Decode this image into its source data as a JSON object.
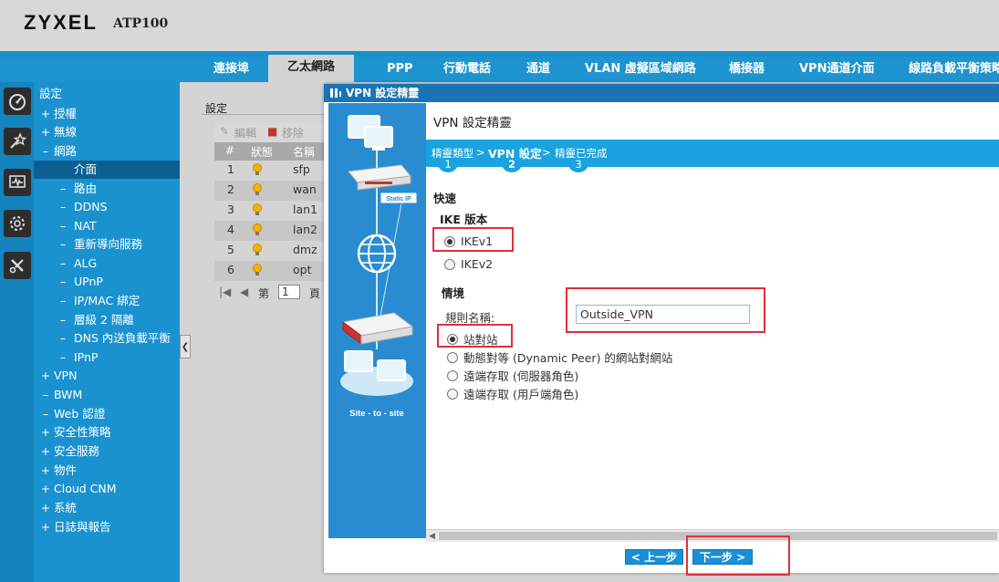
{
  "header": {
    "brand": "ZYXEL",
    "model": "ATP100"
  },
  "tabs": [
    {
      "label": "連接埠",
      "active": false
    },
    {
      "label": "乙太網路",
      "active": true
    },
    {
      "label": "PPP",
      "active": false
    },
    {
      "label": "行動電話",
      "active": false
    },
    {
      "label": "通道",
      "active": false
    },
    {
      "label": "VLAN 虛擬區域網路",
      "active": false
    },
    {
      "label": "橋接器",
      "active": false
    },
    {
      "label": "VPN通道介面",
      "active": false
    },
    {
      "label": "線路負載平衡策略",
      "active": false
    }
  ],
  "iconbar": [
    "dashboard-icon",
    "magic-wand-icon",
    "monitor-icon",
    "gear-icon",
    "tools-icon"
  ],
  "sidebar": {
    "title": "設定",
    "items": [
      {
        "sym": "+",
        "label": "授權"
      },
      {
        "sym": "+",
        "label": "無線"
      },
      {
        "sym": "–",
        "label": "網路"
      },
      {
        "sym": "",
        "label": "介面",
        "selected": true
      },
      {
        "sym": "–",
        "label": "路由"
      },
      {
        "sym": "–",
        "label": "DDNS"
      },
      {
        "sym": "–",
        "label": "NAT"
      },
      {
        "sym": "–",
        "label": "重新導向服務"
      },
      {
        "sym": "–",
        "label": "ALG"
      },
      {
        "sym": "–",
        "label": "UPnP"
      },
      {
        "sym": "–",
        "label": "IP/MAC 綁定"
      },
      {
        "sym": "–",
        "label": "層級 2 隔離"
      },
      {
        "sym": "–",
        "label": "DNS 內送負載平衡"
      },
      {
        "sym": "–",
        "label": "IPnP"
      },
      {
        "sym": "+",
        "label": "VPN"
      },
      {
        "sym": "–",
        "label": "BWM"
      },
      {
        "sym": "–",
        "label": "Web 認證"
      },
      {
        "sym": "+",
        "label": "安全性策略"
      },
      {
        "sym": "+",
        "label": "安全服務"
      },
      {
        "sym": "+",
        "label": "物件"
      },
      {
        "sym": "+",
        "label": "Cloud CNM"
      },
      {
        "sym": "+",
        "label": "系統"
      },
      {
        "sym": "+",
        "label": "日誌與報告"
      }
    ]
  },
  "panel": {
    "title": "設定",
    "edit": "編輯",
    "remove": "移除",
    "columns": [
      "#",
      "狀態",
      "名稱"
    ],
    "rows": [
      {
        "num": "1",
        "name": "sfp"
      },
      {
        "num": "2",
        "name": "wan"
      },
      {
        "num": "3",
        "name": "lan1"
      },
      {
        "num": "4",
        "name": "lan2"
      },
      {
        "num": "5",
        "name": "dmz"
      },
      {
        "num": "6",
        "name": "opt"
      }
    ],
    "pager": {
      "page_label": "第",
      "page_value": "1",
      "page_suffix": "頁"
    }
  },
  "modal": {
    "title": "VPN 設定精靈",
    "heading": "VPN 設定精靈",
    "art_caption": "Site - to - site",
    "art_static_ip": "Static IP",
    "steps": [
      {
        "label": "精靈類型",
        "num": "1"
      },
      {
        "label": "VPN 設定",
        "num": "2",
        "current": true
      },
      {
        "label": "精靈已完成",
        "num": "3"
      }
    ],
    "step_sep": ">",
    "quick": "快速",
    "ike_label": "IKE 版本",
    "ike_options": [
      "IKEv1",
      "IKEv2"
    ],
    "scenario": "情境",
    "rule_name_label": "規則名稱:",
    "rule_name_value": "Outside_VPN",
    "scenario_options": [
      "站對站",
      "動態對等 (Dynamic Peer) 的網站對網站",
      "遠端存取 (伺服器角色)",
      "遠端存取 (用戶端角色)"
    ],
    "prev_button": "< 上一步",
    "next_button": "下一步 >"
  },
  "colors": {
    "accent": "#1a92cf",
    "highlight": "#e0303a",
    "title_bar": "#1a73b4"
  }
}
